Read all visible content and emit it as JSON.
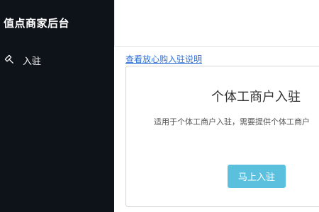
{
  "sidebar": {
    "brand": "值点商家后台",
    "items": [
      {
        "label": "入驻",
        "icon": "gavel-icon"
      }
    ]
  },
  "main": {
    "help_link": "查看放心购入驻说明",
    "card": {
      "title": "个体工商户入驻",
      "description": "适用于个体工商户入驻，需要提供个体工商户",
      "button_label": "马上入驻"
    }
  },
  "colors": {
    "sidebar_bg": "#0e1219",
    "link": "#2a6ed6",
    "button": "#5bc0de"
  }
}
